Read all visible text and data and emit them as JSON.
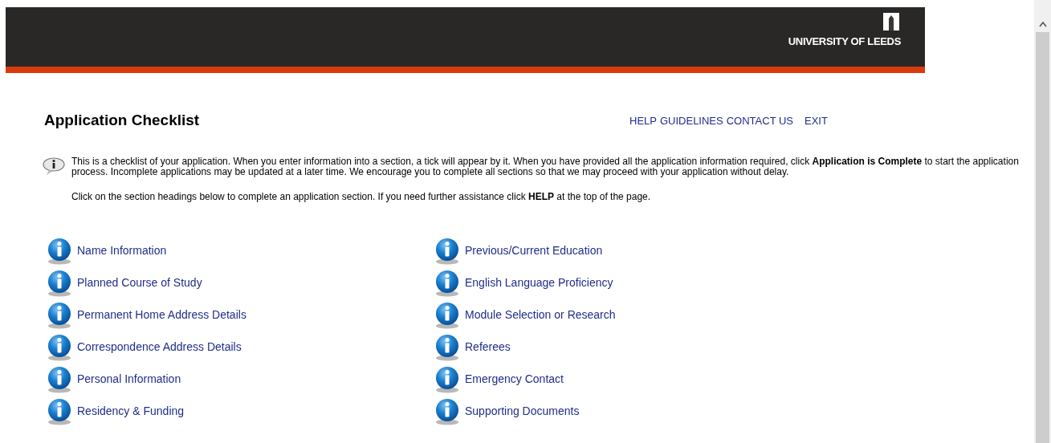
{
  "header": {
    "logo_text": "UNIVERSITY OF LEEDS"
  },
  "title": "Application Checklist",
  "top_links": [
    "HELP",
    "GUIDELINES",
    "CONTACT US",
    "EXIT"
  ],
  "intro": [
    "This is a checklist of your application. When you enter information into a section, a tick will appear by it. When you have provided all the application information required, click **Application is Complete** to start the application process. Incomplete applications may be updated at a later time. We encourage you to complete all sections so that we may proceed with your application without delay.",
    "Click on the section headings below to complete an application section. If you need further assistance click **HELP** at the top of the page."
  ],
  "sections": [
    [
      "Name Information",
      "Planned Course of Study",
      "Permanent Home Address Details",
      "Correspondence Address Details",
      "Personal Information",
      "Residency & Funding"
    ],
    [
      "Previous/Current Education",
      "English Language Proficiency",
      "Module Selection or Research",
      "Referees",
      "Emergency Contact",
      "Supporting Documents"
    ]
  ]
}
